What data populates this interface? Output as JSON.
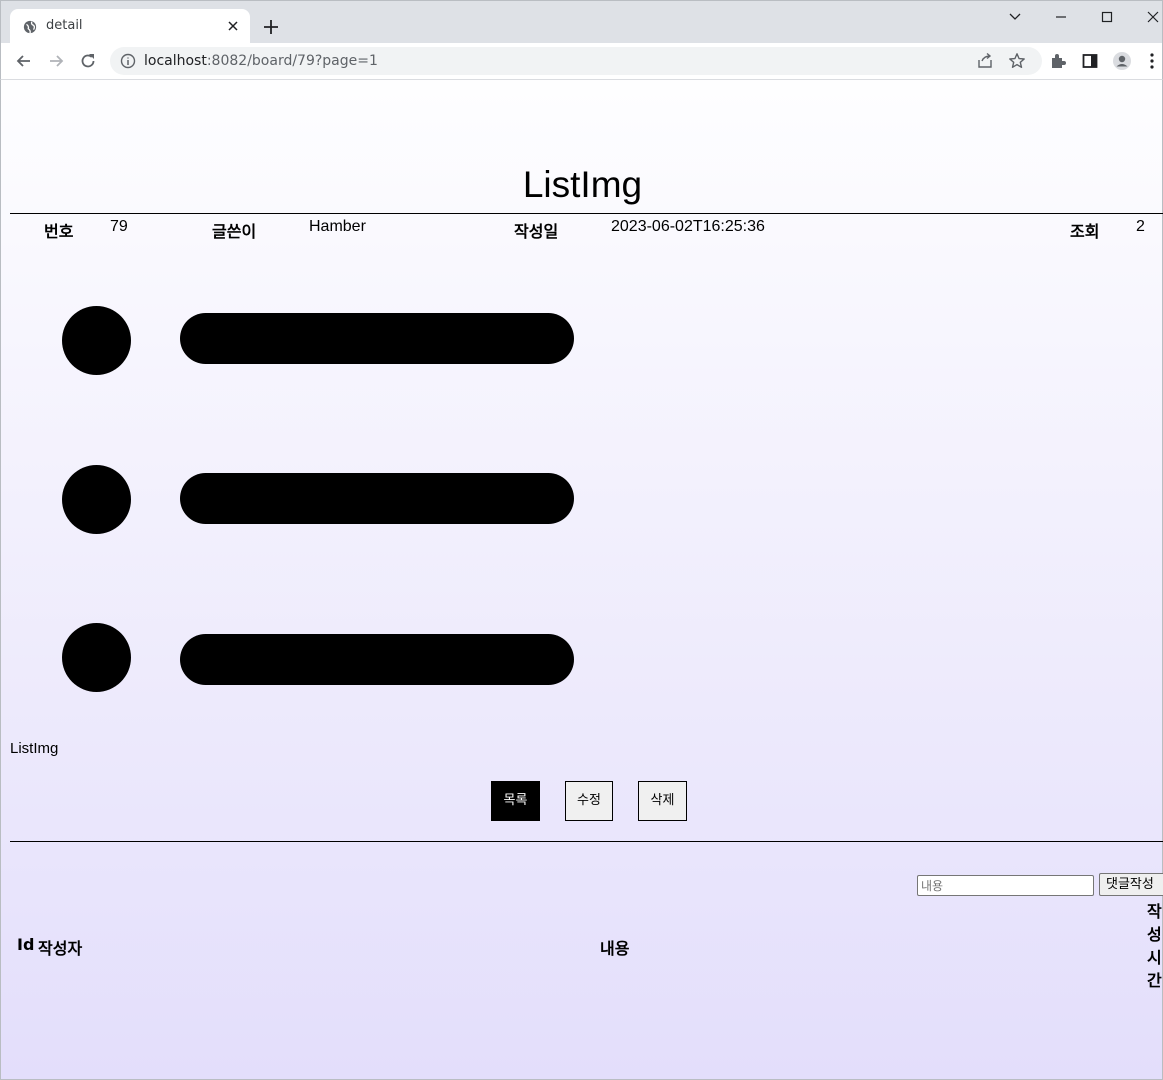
{
  "browser": {
    "tab_title": "detail",
    "url_host": "localhost",
    "url_rest": ":8082/board/79?page=1"
  },
  "post": {
    "title": "ListImg",
    "number_label": "번호",
    "number": "79",
    "writer_label": "글쓴이",
    "writer": "Hamber",
    "date_label": "작성일",
    "date": "2023-06-02T16:25:36",
    "views_label": "조회",
    "views": "2",
    "content": "ListImg"
  },
  "buttons": {
    "list": "목록",
    "edit": "수정",
    "delete": "삭제"
  },
  "comment": {
    "placeholder": "내용",
    "submit": "댓글작성",
    "headers": {
      "id": "Id",
      "writer": "작성자",
      "content": "내용",
      "time": "작성시간"
    }
  },
  "icons": [
    "globe-icon",
    "close-icon",
    "plus-icon",
    "chevron-down-icon",
    "minimize-icon",
    "maximize-icon",
    "back-icon",
    "forward-icon",
    "reload-icon",
    "info-icon",
    "share-icon",
    "star-icon",
    "extensions-icon",
    "side-panel-icon",
    "profile-icon",
    "menu-icon"
  ]
}
